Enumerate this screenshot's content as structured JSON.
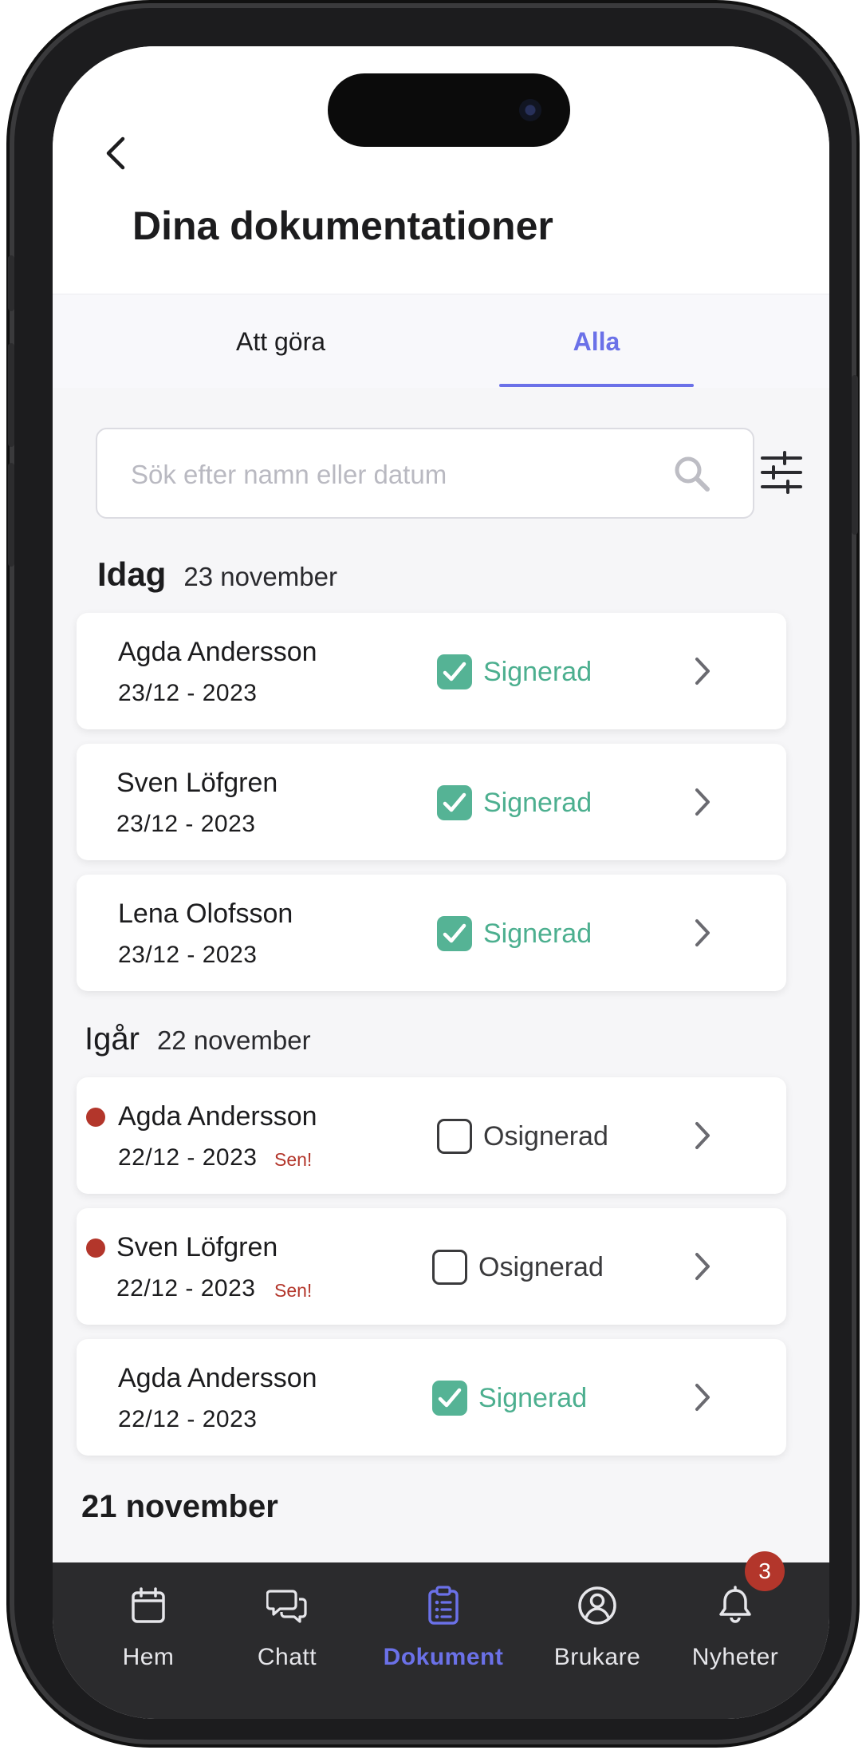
{
  "header": {
    "title": "Dina dokumentationer",
    "back_icon": "chevron-left-icon"
  },
  "tabs": [
    {
      "label": "Att göra",
      "active": false
    },
    {
      "label": "Alla",
      "active": true
    }
  ],
  "search": {
    "placeholder": "Sök efter namn eller datum",
    "icon": "search-icon",
    "filter_icon": "sliders-icon"
  },
  "sections": [
    {
      "day": "Idag",
      "date": "23 november"
    },
    {
      "day": "Igår",
      "date": "22 november"
    },
    {
      "day": "",
      "date": "21 november"
    }
  ],
  "entries": [
    {
      "name": "Agda Andersson",
      "date": "23/12 - 2023",
      "status": "Signerad",
      "late": false
    },
    {
      "name": "Sven Löfgren",
      "date": "23/12 - 2023",
      "status": "Signerad",
      "late": false
    },
    {
      "name": "Lena Olofsson",
      "date": "23/12 - 2023",
      "status": "Signerad",
      "late": false
    },
    {
      "name": "Agda Andersson",
      "date": "22/12 - 2023",
      "status": "Osignerad",
      "late": true,
      "late_label": "Sen!"
    },
    {
      "name": "Sven Löfgren",
      "date": "22/12 - 2023",
      "status": "Osignerad",
      "late": true,
      "late_label": "Sen!"
    },
    {
      "name": "Agda Andersson",
      "date": "22/12 - 2023",
      "status": "Signerad",
      "late": false
    }
  ],
  "nav": [
    {
      "label": "Hem",
      "icon": "calendar-icon",
      "active": false
    },
    {
      "label": "Chatt",
      "icon": "chat-icon",
      "active": false
    },
    {
      "label": "Dokument",
      "icon": "clipboard-icon",
      "active": true
    },
    {
      "label": "Brukare",
      "icon": "user-circle-icon",
      "active": false
    },
    {
      "label": "Nyheter",
      "icon": "bell-icon",
      "active": false,
      "badge": "3"
    }
  ],
  "colors": {
    "accent": "#6b71e8",
    "signed": "#4caf8f",
    "late": "#b3362b",
    "nav_background": "#2b2b2d"
  }
}
